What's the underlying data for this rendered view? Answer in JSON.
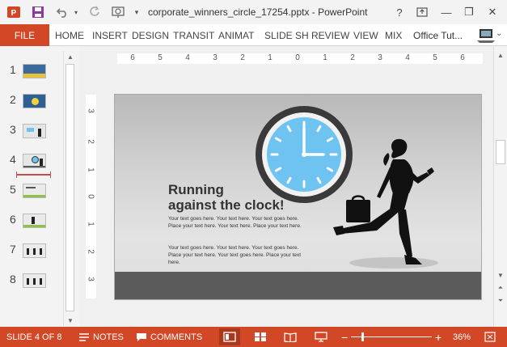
{
  "window": {
    "title": "corporate_winners_circle_17254.pptx - PowerPoint",
    "help_label": "?",
    "minimize_label": "—",
    "restore_label": "❐",
    "close_label": "✕"
  },
  "qat": {
    "app_icon": "powerpoint-icon",
    "save_icon": "save-icon",
    "undo_icon": "undo-icon",
    "redo_icon": "redo-icon",
    "present_icon": "start-from-beginning-icon",
    "customize_icon": "chevron-down-icon"
  },
  "ribbon": {
    "tabs": [
      {
        "label": "FILE"
      },
      {
        "label": "HOME"
      },
      {
        "label": "INSERT"
      },
      {
        "label": "DESIGN"
      },
      {
        "label": "TRANSIT"
      },
      {
        "label": "ANIMAT"
      },
      {
        "label": "SLIDE SH"
      },
      {
        "label": "REVIEW"
      },
      {
        "label": "VIEW"
      },
      {
        "label": "MIX"
      }
    ],
    "account_label": "Office Tut...",
    "accent_color": "#d24726"
  },
  "thumbnails": {
    "numbers": [
      "1",
      "2",
      "3",
      "4",
      "5",
      "6",
      "7",
      "8"
    ],
    "selected": "4"
  },
  "rulers": {
    "horizontal": [
      "6",
      "5",
      "4",
      "3",
      "2",
      "1",
      "0",
      "1",
      "2",
      "3",
      "4",
      "5",
      "6"
    ],
    "vertical": [
      "3",
      "2",
      "1",
      "0",
      "1",
      "2",
      "3"
    ]
  },
  "slide": {
    "heading_line1": "Running",
    "heading_line2": "against the clock!",
    "para1": "Your text goes here. Your text here. Your text goes here. Place your text here. Your text here. Place your text here.",
    "para2": "Your text goes here. Your text here. Your text goes here. Place your text here. Your text goes here. Place your text here.",
    "clock_color": "#6ec3f0",
    "clock_time": "3:00"
  },
  "statusbar": {
    "slide_info": "SLIDE 4 OF 8",
    "notes_label": "NOTES",
    "comments_label": "COMMENTS",
    "zoom_minus": "−",
    "zoom_plus": "+",
    "zoom_level": "36%",
    "zoom_fraction": 0.36
  }
}
